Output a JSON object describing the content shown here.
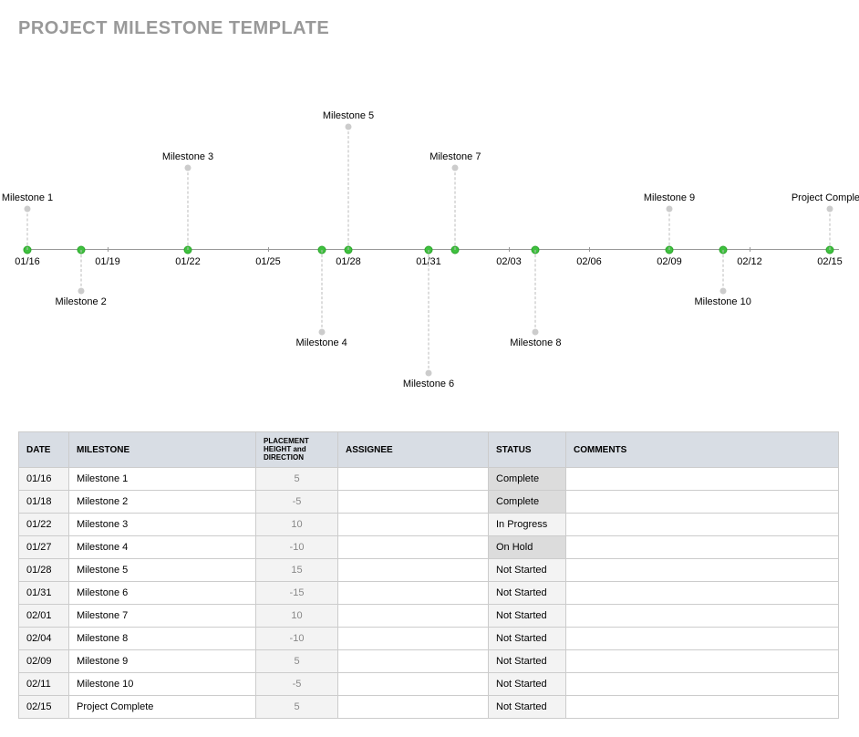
{
  "title": "PROJECT MILESTONE TEMPLATE",
  "chart_data": {
    "type": "timeline",
    "axis_ticks": [
      "01/16",
      "01/19",
      "01/22",
      "01/25",
      "01/28",
      "01/31",
      "02/03",
      "02/06",
      "02/09",
      "02/12",
      "02/15"
    ],
    "x_range_days": [
      "01/16",
      "02/15"
    ],
    "milestones": [
      {
        "date": "01/16",
        "label": "Milestone 1",
        "height": 5
      },
      {
        "date": "01/18",
        "label": "Milestone 2",
        "height": -5
      },
      {
        "date": "01/22",
        "label": "Milestone 3",
        "height": 10
      },
      {
        "date": "01/27",
        "label": "Milestone 4",
        "height": -10
      },
      {
        "date": "01/28",
        "label": "Milestone 5",
        "height": 15
      },
      {
        "date": "01/31",
        "label": "Milestone 6",
        "height": -15
      },
      {
        "date": "02/01",
        "label": "Milestone 7",
        "height": 10
      },
      {
        "date": "02/04",
        "label": "Milestone 8",
        "height": -10
      },
      {
        "date": "02/09",
        "label": "Milestone 9",
        "height": 5
      },
      {
        "date": "02/11",
        "label": "Milestone 10",
        "height": -5
      },
      {
        "date": "02/15",
        "label": "Project Complete",
        "height": 5
      }
    ]
  },
  "table": {
    "headers": {
      "date": "DATE",
      "milestone": "MILESTONE",
      "placement": "PLACEMENT HEIGHT and DIRECTION",
      "assignee": "ASSIGNEE",
      "status": "STATUS",
      "comments": "COMMENTS"
    },
    "rows": [
      {
        "date": "01/16",
        "milestone": "Milestone 1",
        "placement": "5",
        "assignee": "",
        "status": "Complete",
        "comments": "",
        "hl": true
      },
      {
        "date": "01/18",
        "milestone": "Milestone 2",
        "placement": "-5",
        "assignee": "",
        "status": "Complete",
        "comments": "",
        "hl": true
      },
      {
        "date": "01/22",
        "milestone": "Milestone 3",
        "placement": "10",
        "assignee": "",
        "status": "In Progress",
        "comments": "",
        "hl": false
      },
      {
        "date": "01/27",
        "milestone": "Milestone 4",
        "placement": "-10",
        "assignee": "",
        "status": "On Hold",
        "comments": "",
        "hl": true
      },
      {
        "date": "01/28",
        "milestone": "Milestone 5",
        "placement": "15",
        "assignee": "",
        "status": "Not Started",
        "comments": "",
        "hl": false
      },
      {
        "date": "01/31",
        "milestone": "Milestone 6",
        "placement": "-15",
        "assignee": "",
        "status": "Not Started",
        "comments": "",
        "hl": false
      },
      {
        "date": "02/01",
        "milestone": "Milestone 7",
        "placement": "10",
        "assignee": "",
        "status": "Not Started",
        "comments": "",
        "hl": false
      },
      {
        "date": "02/04",
        "milestone": "Milestone 8",
        "placement": "-10",
        "assignee": "",
        "status": "Not Started",
        "comments": "",
        "hl": false
      },
      {
        "date": "02/09",
        "milestone": "Milestone 9",
        "placement": "5",
        "assignee": "",
        "status": "Not Started",
        "comments": "",
        "hl": false
      },
      {
        "date": "02/11",
        "milestone": "Milestone 10",
        "placement": "-5",
        "assignee": "",
        "status": "Not Started",
        "comments": "",
        "hl": false
      },
      {
        "date": "02/15",
        "milestone": "Project Complete",
        "placement": "5",
        "assignee": "",
        "status": "Not Started",
        "comments": "",
        "hl": false
      }
    ]
  }
}
